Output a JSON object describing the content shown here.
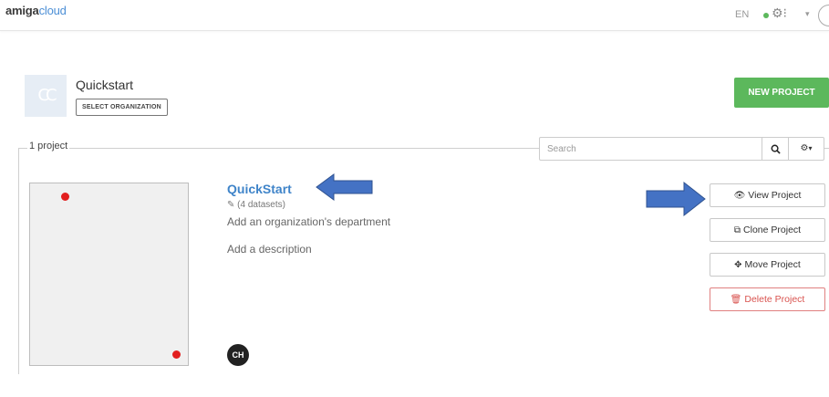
{
  "header": {
    "logo_part1": "amiga",
    "logo_part2": "cloud",
    "language": "EN",
    "settings_glyph": "⚙⁝",
    "caret": "▾",
    "status_color": "#5cb85c"
  },
  "organization": {
    "logo_initials": "CC",
    "name": "Quickstart",
    "select_label": "SELECT ORGANIZATION"
  },
  "toolbar": {
    "new_project_label": "NEW PROJECT",
    "project_count": "1 project",
    "search_placeholder": "Search",
    "search_icon": "search-icon",
    "settings_icon": "gear-icon"
  },
  "project": {
    "title": "QuickStart",
    "datasets": "(4 datasets)",
    "department": "Add an organization's department",
    "description": "Add a description",
    "owner_initials": "CH"
  },
  "actions": [
    {
      "label": "View Project",
      "icon": "eye-icon",
      "glyph": "👁"
    },
    {
      "label": "Clone Project",
      "icon": "clone-icon",
      "glyph": "⧉"
    },
    {
      "label": "Move Project",
      "icon": "move-icon",
      "glyph": "✥"
    },
    {
      "label": "Delete Project",
      "icon": "trash-icon",
      "glyph": "🗑"
    }
  ],
  "colors": {
    "accent_green": "#5cb85c",
    "link_blue": "#3f84c9",
    "danger_red": "#d9534f",
    "arrow_blue": "#4472c4"
  }
}
